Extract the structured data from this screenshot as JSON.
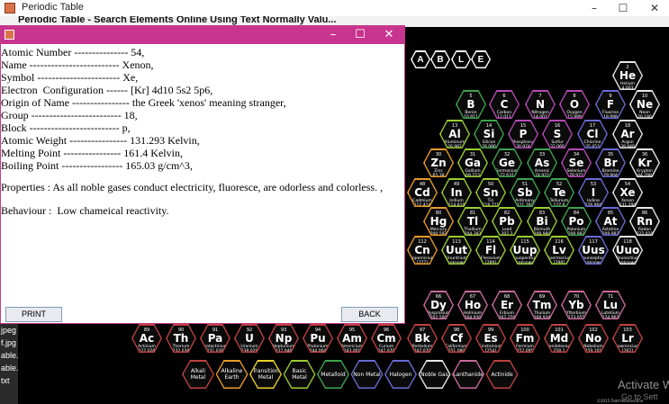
{
  "main_window": {
    "title": "Periodic Table",
    "header_text": "Periodic Table - Search Elements Online Using Text Normally Valu..."
  },
  "window_controls": {
    "minimize": "–",
    "maximize": "☐",
    "close": "✕"
  },
  "desktop_items": [
    "jpeg",
    "f.jpg",
    "able.",
    "able.t",
    "txt"
  ],
  "able_letters": [
    "A",
    "B",
    "L",
    "E"
  ],
  "elements": [
    {
      "n": "2",
      "s": "He",
      "name": "Helium",
      "w": "4.003",
      "c": "#e8e8e8"
    },
    {
      "n": "5",
      "s": "B",
      "name": "Boron",
      "w": "10.811",
      "c": "#3fa34d"
    },
    {
      "n": "6",
      "s": "C",
      "name": "Carbon",
      "w": "12.011",
      "c": "#b54ab5"
    },
    {
      "n": "7",
      "s": "N",
      "name": "Nitrogen",
      "w": "14.007",
      "c": "#b54ab5"
    },
    {
      "n": "8",
      "s": "O",
      "name": "Oxygen",
      "w": "15.999",
      "c": "#b54ab5"
    },
    {
      "n": "9",
      "s": "F",
      "name": "Fluorine",
      "w": "18.998",
      "c": "#6a6ad4"
    },
    {
      "n": "10",
      "s": "Ne",
      "name": "Neon",
      "w": "20.180",
      "c": "#e8e8e8"
    },
    {
      "n": "13",
      "s": "Al",
      "name": "Aluminum",
      "w": "26.982",
      "c": "#9acd32"
    },
    {
      "n": "14",
      "s": "Si",
      "name": "Silicon",
      "w": "28.086",
      "c": "#3fa34d"
    },
    {
      "n": "15",
      "s": "P",
      "name": "Phosphorus",
      "w": "30.974",
      "c": "#b54ab5"
    },
    {
      "n": "16",
      "s": "S",
      "name": "Sulfur",
      "w": "32.066",
      "c": "#b54ab5"
    },
    {
      "n": "17",
      "s": "Cl",
      "name": "Chlorine",
      "w": "35.453",
      "c": "#6a6ad4"
    },
    {
      "n": "18",
      "s": "Ar",
      "name": "Argon",
      "w": "39.948",
      "c": "#e8e8e8"
    },
    {
      "n": "30",
      "s": "Zn",
      "name": "Zinc",
      "w": "65.38",
      "c": "#e89a2a"
    },
    {
      "n": "31",
      "s": "Ga",
      "name": "Gallium",
      "w": "69.723",
      "c": "#9acd32"
    },
    {
      "n": "32",
      "s": "Ge",
      "name": "Germanium",
      "w": "72.631",
      "c": "#3fa34d"
    },
    {
      "n": "33",
      "s": "As",
      "name": "Arsenic",
      "w": "74.922",
      "c": "#3fa34d"
    },
    {
      "n": "34",
      "s": "Se",
      "name": "Selenium",
      "w": "78.972",
      "c": "#b54ab5"
    },
    {
      "n": "35",
      "s": "Br",
      "name": "Bromine",
      "w": "79.904",
      "c": "#6a6ad4"
    },
    {
      "n": "36",
      "s": "Kr",
      "name": "Krypton",
      "w": "84.798",
      "c": "#e8e8e8"
    },
    {
      "n": "48",
      "s": "Cd",
      "name": "Cadmium",
      "w": "112.414",
      "c": "#e89a2a"
    },
    {
      "n": "49",
      "s": "In",
      "name": "Indium",
      "w": "114.818",
      "c": "#9acd32"
    },
    {
      "n": "50",
      "s": "Sn",
      "name": "Tin",
      "w": "118.711",
      "c": "#9acd32"
    },
    {
      "n": "51",
      "s": "Sb",
      "name": "Antimony",
      "w": "121.760",
      "c": "#3fa34d"
    },
    {
      "n": "52",
      "s": "Te",
      "name": "Tellurium",
      "w": "127.6",
      "c": "#3fa34d"
    },
    {
      "n": "53",
      "s": "I",
      "name": "Iodine",
      "w": "126.904",
      "c": "#6a6ad4"
    },
    {
      "n": "54",
      "s": "Xe",
      "name": "Xenon",
      "w": "131.294",
      "c": "#e8e8e8"
    },
    {
      "n": "80",
      "s": "Hg",
      "name": "Mercury",
      "w": "200.592",
      "c": "#e89a2a"
    },
    {
      "n": "81",
      "s": "Tl",
      "name": "Thallium",
      "w": "204.383",
      "c": "#9acd32"
    },
    {
      "n": "82",
      "s": "Pb",
      "name": "Lead",
      "w": "207.2",
      "c": "#9acd32"
    },
    {
      "n": "83",
      "s": "Bi",
      "name": "Bismuth",
      "w": "208.980",
      "c": "#9acd32"
    },
    {
      "n": "84",
      "s": "Po",
      "name": "Polonium",
      "w": "[208.982]",
      "c": "#3fa34d"
    },
    {
      "n": "85",
      "s": "At",
      "name": "Astatine",
      "w": "209.987",
      "c": "#6a6ad4"
    },
    {
      "n": "86",
      "s": "Rn",
      "name": "Radon",
      "w": "222.018",
      "c": "#e8e8e8"
    },
    {
      "n": "112",
      "s": "Cn",
      "name": "Copernicium",
      "w": "[277]",
      "c": "#e89a2a"
    },
    {
      "n": "113",
      "s": "Uut",
      "name": "Ununtrium",
      "w": "unknown",
      "c": "#9acd32"
    },
    {
      "n": "114",
      "s": "Fl",
      "name": "Flerovium",
      "w": "[289]",
      "c": "#9acd32"
    },
    {
      "n": "115",
      "s": "Uup",
      "name": "Ununpentium",
      "w": "unknown",
      "c": "#9acd32"
    },
    {
      "n": "116",
      "s": "Lv",
      "name": "Livermorium",
      "w": "[298]",
      "c": "#9acd32"
    },
    {
      "n": "117",
      "s": "Uus",
      "name": "Ununseptium",
      "w": "unknown",
      "c": "#6a6ad4"
    },
    {
      "n": "118",
      "s": "Uuo",
      "name": "Ununoctium",
      "w": "unknown",
      "c": "#e8e8e8"
    },
    {
      "n": "66",
      "s": "Dy",
      "name": "Dysprosium",
      "w": "162.500",
      "c": "#c96a9a"
    },
    {
      "n": "67",
      "s": "Ho",
      "name": "Holmium",
      "w": "164.930",
      "c": "#c96a9a"
    },
    {
      "n": "68",
      "s": "Er",
      "name": "Erbium",
      "w": "167.259",
      "c": "#c96a9a"
    },
    {
      "n": "69",
      "s": "Tm",
      "name": "Thulium",
      "w": "168.934",
      "c": "#c96a9a"
    },
    {
      "n": "70",
      "s": "Yb",
      "name": "Ytterbium",
      "w": "173.055",
      "c": "#c96a9a"
    },
    {
      "n": "71",
      "s": "Lu",
      "name": "Lutetium",
      "w": "174.967",
      "c": "#c96a9a"
    },
    {
      "n": "89",
      "s": "Ac",
      "name": "Actinium",
      "w": "227.028",
      "c": "#c04040"
    },
    {
      "n": "90",
      "s": "Th",
      "name": "Thorium",
      "w": "232.038",
      "c": "#c04040"
    },
    {
      "n": "91",
      "s": "Pa",
      "name": "Protactinium",
      "w": "231.036",
      "c": "#c04040"
    },
    {
      "n": "92",
      "s": "U",
      "name": "Uranium",
      "w": "238.029",
      "c": "#c04040"
    },
    {
      "n": "93",
      "s": "Np",
      "name": "Neptunium",
      "w": "237.048",
      "c": "#c04040"
    },
    {
      "n": "94",
      "s": "Pu",
      "name": "Plutonium",
      "w": "244.064",
      "c": "#c04040"
    },
    {
      "n": "95",
      "s": "Am",
      "name": "Americium",
      "w": "243.061",
      "c": "#c04040"
    },
    {
      "n": "96",
      "s": "Cm",
      "name": "Curium",
      "w": "247.070",
      "c": "#c04040"
    },
    {
      "n": "97",
      "s": "Bk",
      "name": "Berkelium",
      "w": "247.070",
      "c": "#c04040"
    },
    {
      "n": "98",
      "s": "Cf",
      "name": "Californium",
      "w": "251.080",
      "c": "#c04040"
    },
    {
      "n": "99",
      "s": "Es",
      "name": "Einsteinium",
      "w": "[254]",
      "c": "#c04040"
    },
    {
      "n": "100",
      "s": "Fm",
      "name": "Fermium",
      "w": "257.095",
      "c": "#c04040"
    },
    {
      "n": "101",
      "s": "Md",
      "name": "Mendelevium",
      "w": "258.1",
      "c": "#c04040"
    },
    {
      "n": "102",
      "s": "No",
      "name": "Nobelium",
      "w": "259.101",
      "c": "#c04040"
    },
    {
      "n": "103",
      "s": "Lr",
      "name": "Lawrencium",
      "w": "[262]",
      "c": "#c04040"
    }
  ],
  "legend": [
    {
      "label": "Alkali Metal",
      "c": "#c04040"
    },
    {
      "label": "Alkaline Earth",
      "c": "#e89a2a"
    },
    {
      "label": "Transition Metal",
      "c": "#e8d02a"
    },
    {
      "label": "Basic Metal",
      "c": "#9acd32"
    },
    {
      "label": "Metalloid",
      "c": "#3fa34d"
    },
    {
      "label": "Non Metal",
      "c": "#6a6ad4"
    },
    {
      "label": "Halogen",
      "c": "#6a6ad4"
    },
    {
      "label": "Noble Gas",
      "c": "#e8e8e8"
    },
    {
      "label": "Lanthanide",
      "c": "#c96a9a"
    },
    {
      "label": "Actinide",
      "c": "#c04040"
    }
  ],
  "watermark": {
    "line1": "Activate W",
    "line2": "Go to Sett"
  },
  "copyright": "©2015 Todd Helmenstine",
  "dialog": {
    "info_lines": [
      "Atomic Number --------------- 54,",
      "Name ------------------------- Xenon,",
      "Symbol ----------------------- Xe,",
      "Electron  Configuration ------ [Kr] 4d10 5s2 5p6,",
      "Origin of Name ---------------- the Greek 'xenos' meaning stranger,",
      "Group ------------------------- 18,",
      "Block ------------------------- p,",
      "Atomic Weight ---------------- 131.293 Kelvin,",
      "Melting Point ---------------- 161.4 Kelvin,",
      "Boiling Point ----------------- 165.03 g/cm^3,",
      "",
      "Properties : As all noble gases conduct electricity, fluoresce, are odorless and colorless. ,",
      "",
      "Behaviour :  Low chameical reactivity."
    ],
    "print_label": "PRINT",
    "back_label": "BACK"
  }
}
